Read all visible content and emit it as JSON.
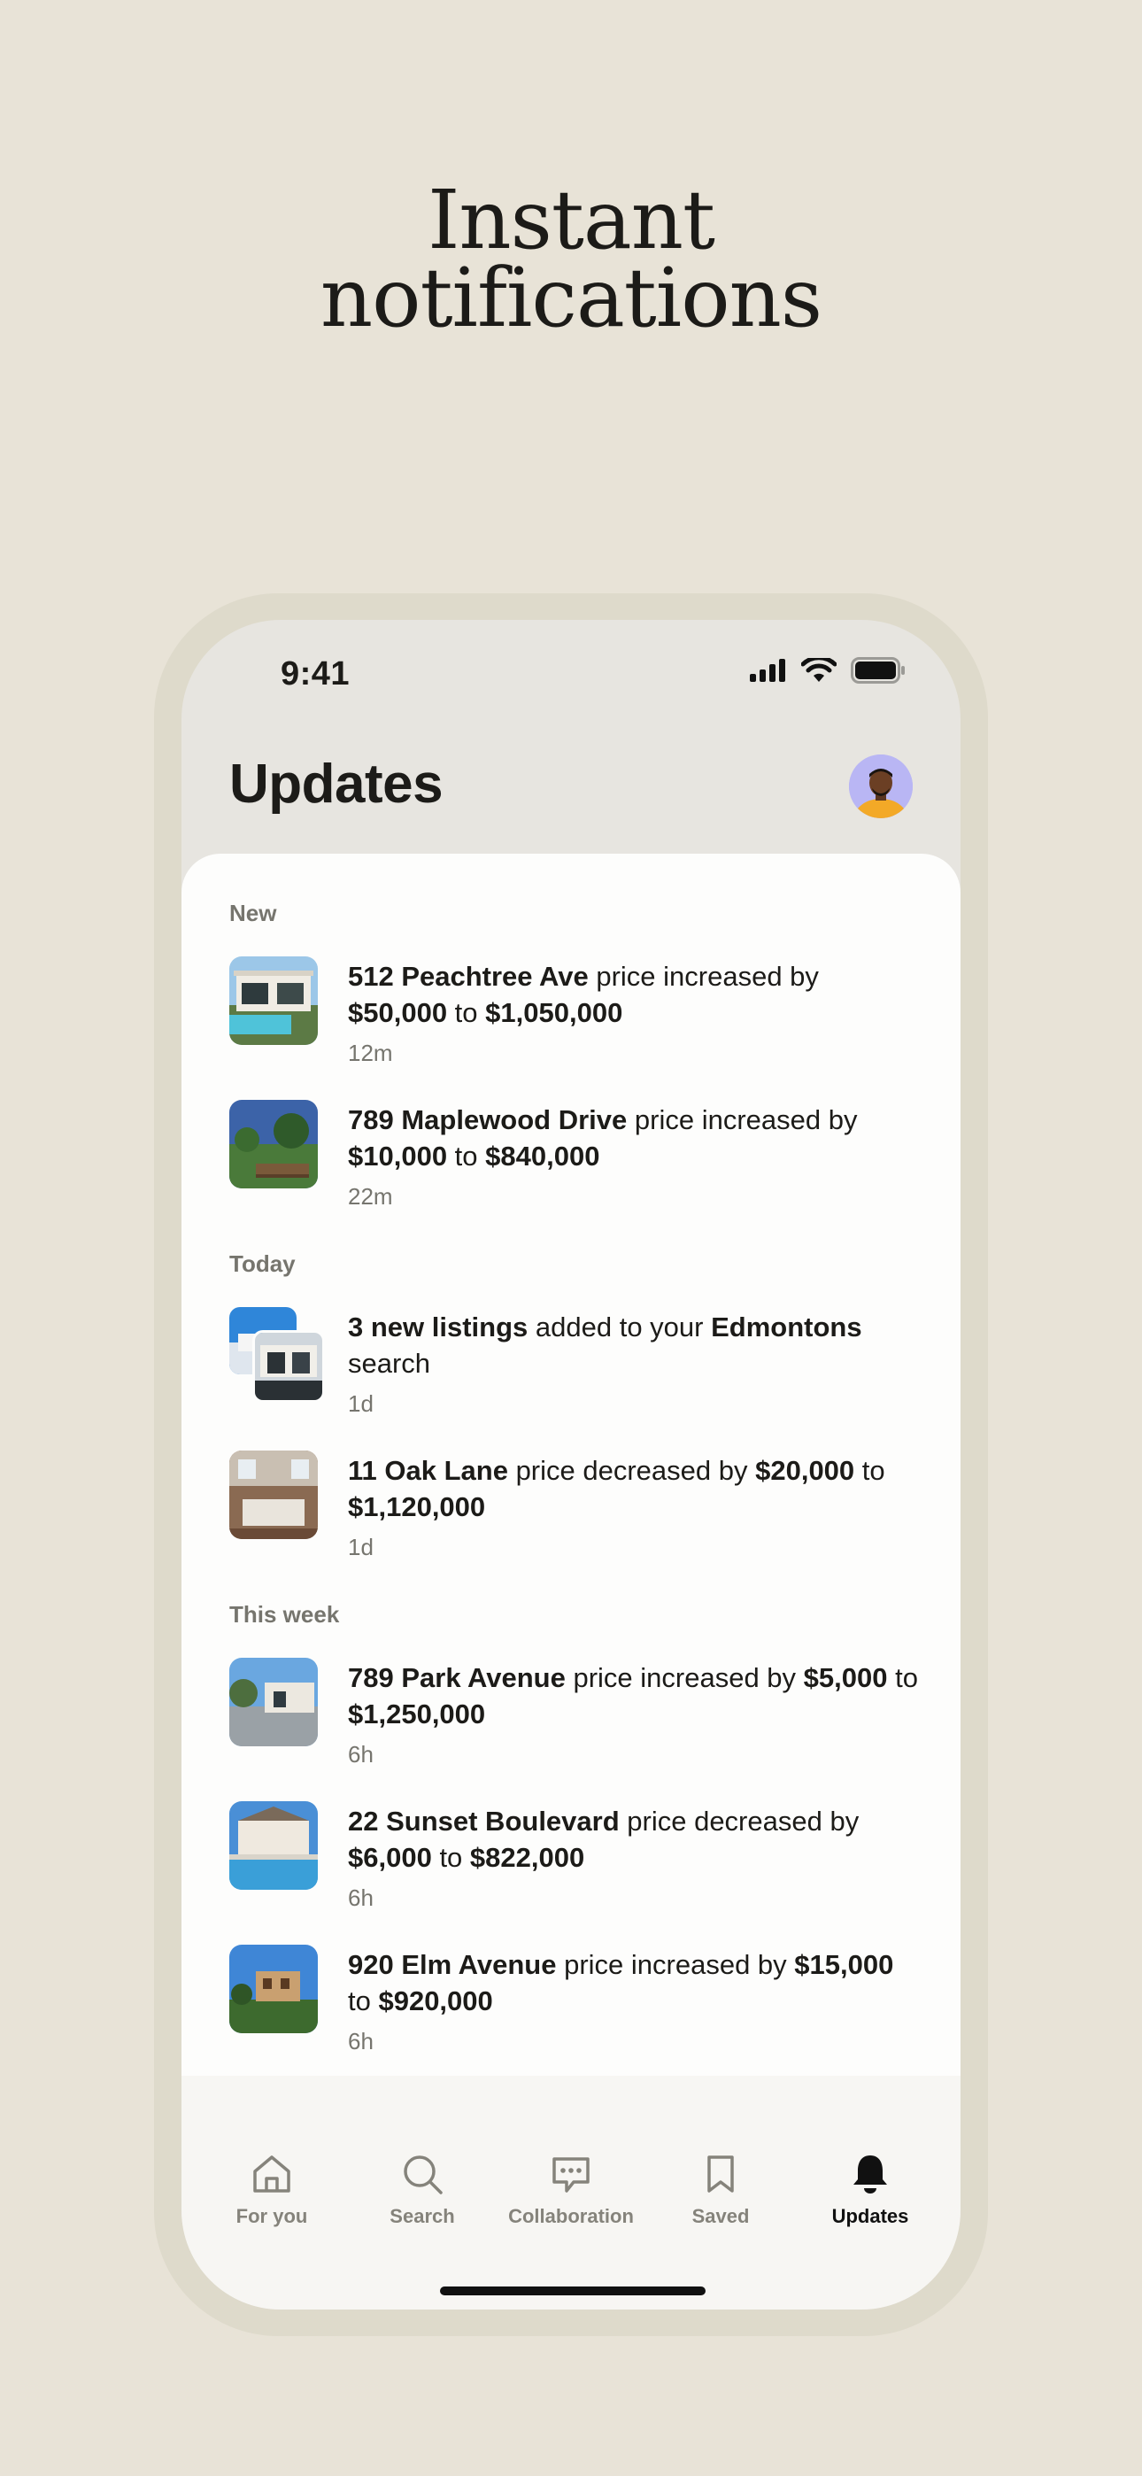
{
  "headline": {
    "line1": "Instant",
    "line2": "notifications"
  },
  "status_bar": {
    "time": "9:41"
  },
  "header": {
    "title": "Updates"
  },
  "sections": {
    "new": "New",
    "today": "Today",
    "this_week": "This week"
  },
  "items": [
    {
      "p1": "512 Peachtree Ave",
      "p2": " price increased by ",
      "p3": "$50,000",
      "p4": " to ",
      "p5": "$1,050,000",
      "time": "12m"
    },
    {
      "p1": "789 Maplewood Drive",
      "p2": " price increased by ",
      "p3": "$10,000",
      "p4": " to ",
      "p5": "$840,000",
      "time": "22m"
    },
    {
      "p1": "3 new listings",
      "p2": " added to your ",
      "p3": "Edmontons",
      "p4": " search",
      "time": "1d"
    },
    {
      "p1": "11 Oak Lane",
      "p2": " price decreased by ",
      "p3": "$20,000",
      "p4": " to ",
      "p5": "$1,120,000",
      "time": "1d"
    },
    {
      "p1": "789 Park Avenue",
      "p2": " price increased by ",
      "p3": "$5,000",
      "p4": " to ",
      "p5": "$1,250,000",
      "time": "6h"
    },
    {
      "p1": "22 Sunset Boulevard",
      "p2": " price decreased by ",
      "p3": "$6,000",
      "p4": " to ",
      "p5": "$822,000",
      "time": "6h"
    },
    {
      "p1": "920 Elm Avenue",
      "p2": " price increased by ",
      "p3": "$15,000",
      "p4": " to ",
      "p5": "$920,000",
      "time": "6h"
    }
  ],
  "tabs": [
    {
      "label": "For you",
      "icon": "home-icon"
    },
    {
      "label": "Search",
      "icon": "search-icon"
    },
    {
      "label": "Collaboration",
      "icon": "chat-icon"
    },
    {
      "label": "Saved",
      "icon": "bookmark-icon"
    },
    {
      "label": "Updates",
      "icon": "bell-icon",
      "active": true
    }
  ],
  "colors": {
    "background": "#e8e3d7",
    "sheet": "#fdfdfc",
    "muted_text": "#76756e",
    "active_tab": "#111111"
  }
}
